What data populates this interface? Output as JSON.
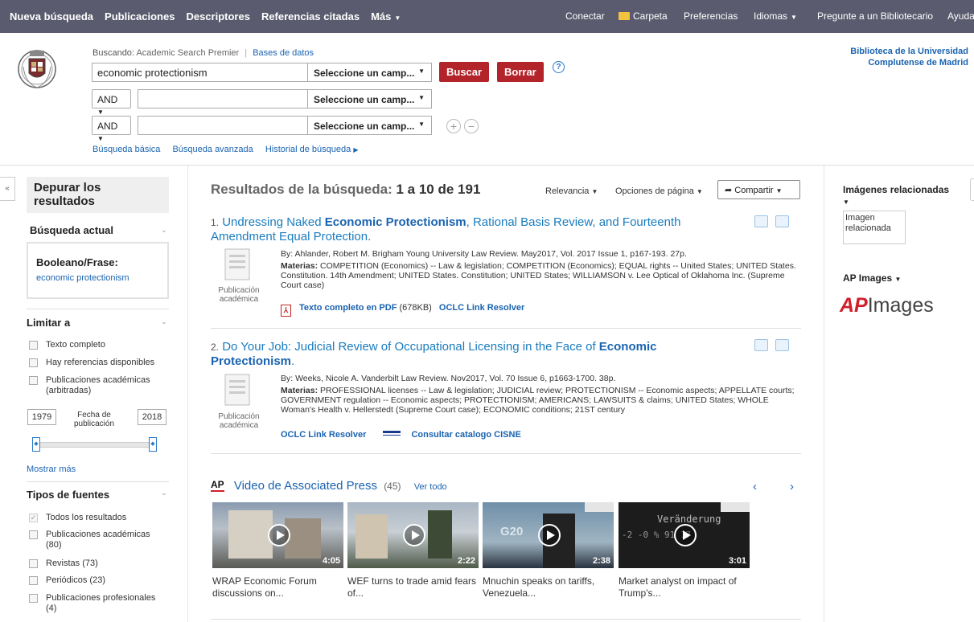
{
  "topnav": {
    "left": [
      "Nueva búsqueda",
      "Publicaciones",
      "Descriptores",
      "Referencias citadas",
      "Más"
    ],
    "right": [
      "Conectar",
      "Carpeta",
      "Preferencias",
      "Idiomas",
      "Pregunte a un Bibliotecario",
      "Ayuda"
    ]
  },
  "search": {
    "buscando_label": "Buscando:",
    "database": "Academic Search Premier",
    "databases_link": "Bases de datos",
    "query": "economic protectionism",
    "field_placeholder": "Seleccione un camp...",
    "bool1": "AND",
    "bool2": "AND",
    "buscar": "Buscar",
    "borrar": "Borrar",
    "help": "?",
    "links": [
      "Búsqueda básica",
      "Búsqueda avanzada",
      "Historial de búsqueda"
    ]
  },
  "library": {
    "line1": "Biblioteca de la Universidad",
    "line2": "Complutense de Madrid"
  },
  "sidebar": {
    "title": "Depurar los resultados",
    "current": "Búsqueda actual",
    "bool_label": "Booleano/Frase:",
    "bool_value": "economic protectionism",
    "limit": "Limitar a",
    "limits": [
      "Texto completo",
      "Hay referencias disponibles",
      "Publicaciones académicas (arbitradas)"
    ],
    "date_from": "1979",
    "date_label": "Fecha de publicación",
    "date_to": "2018",
    "slider_range": [
      1979,
      2018
    ],
    "more": "Mostrar más",
    "source_types": "Tipos de fuentes",
    "sources": [
      {
        "label": "Todos los resultados",
        "checked": true
      },
      {
        "label": "Publicaciones académicas (80)",
        "checked": false
      },
      {
        "label": "Revistas (73)",
        "checked": false
      },
      {
        "label": "Periódicos (23)",
        "checked": false
      },
      {
        "label": "Publicaciones profesionales (4)",
        "checked": false
      }
    ]
  },
  "results": {
    "heading": "Resultados de la búsqueda:",
    "range": "1 a 10 de 191",
    "sort": "Relevancia",
    "page_options": "Opciones de página",
    "share": "Compartir",
    "items": [
      {
        "num": "1.",
        "title_pre": "Undressing Naked ",
        "title_bold": "Economic Protectionism",
        "title_post": ", Rational Basis Review, and Fourteenth Amendment Equal Protection.",
        "byline": "By: Ahlander, Robert M. Brigham Young University Law Review. May2017, Vol. 2017 Issue 1, p167-193. 27p.",
        "subjects_label": "Materias:",
        "subjects": "COMPETITION (Economics) -- Law & legislation; COMPETITION (Economics); EQUAL rights -- United States; UNITED States. Constitution. 14th Amendment; UNITED States. Constitution; UNITED States; WILLIAMSON v. Lee Optical of Oklahoma Inc. (Supreme Court case)",
        "type": "Publicación académica",
        "pdf_link": "Texto completo en PDF",
        "pdf_size": "(678KB)",
        "oclc": "OCLC Link Resolver"
      },
      {
        "num": "2.",
        "title_pre": "Do Your Job: Judicial Review of Occupational Licensing in the Face of ",
        "title_bold": "Economic Protectionism",
        "title_post": ".",
        "byline": "By: Weeks, Nicole A. Vanderbilt Law Review. Nov2017, Vol. 70 Issue 6, p1663-1700. 38p.",
        "subjects_label": "Materias:",
        "subjects": "PROFESSIONAL licenses -- Law & legislation; JUDICIAL review; PROTECTIONISM -- Economic aspects; APPELLATE courts; GOVERNMENT regulation -- Economic aspects; PROTECTIONISM; AMERICANS; LAWSUITS & claims; UNITED States; WHOLE Woman's Health v. Hellerstedt (Supreme Court case); ECONOMIC conditions; 21ST century",
        "type": "Publicación académica",
        "oclc": "OCLC Link Resolver",
        "cisne": "Consultar catalogo CISNE"
      }
    ]
  },
  "ap_video": {
    "logo": "AP",
    "heading": "Video de Associated Press",
    "count": "(45)",
    "see_all": "Ver todo",
    "prev": "‹",
    "next": "›",
    "videos": [
      {
        "caption": "WRAP Economic Forum discussions on...",
        "duration": "4:05"
      },
      {
        "caption": "WEF turns to trade amid fears of...",
        "duration": "2:22"
      },
      {
        "caption": "Mnuchin speaks on tariffs, Venezuela...",
        "duration": "2:38"
      },
      {
        "caption": "Market analyst on impact of Trump's...",
        "duration": "3:01"
      }
    ],
    "thumb_text_1": "G20",
    "thumb_text_2": "Veränderung",
    "thumb_text_3": "-2 -0 % 91 17"
  },
  "right": {
    "related_images": "Imágenes relacionadas",
    "img_alt": "Imagen relacionada",
    "ap_images": "AP Images",
    "logo_ap": "AP",
    "logo_images": "Images"
  }
}
